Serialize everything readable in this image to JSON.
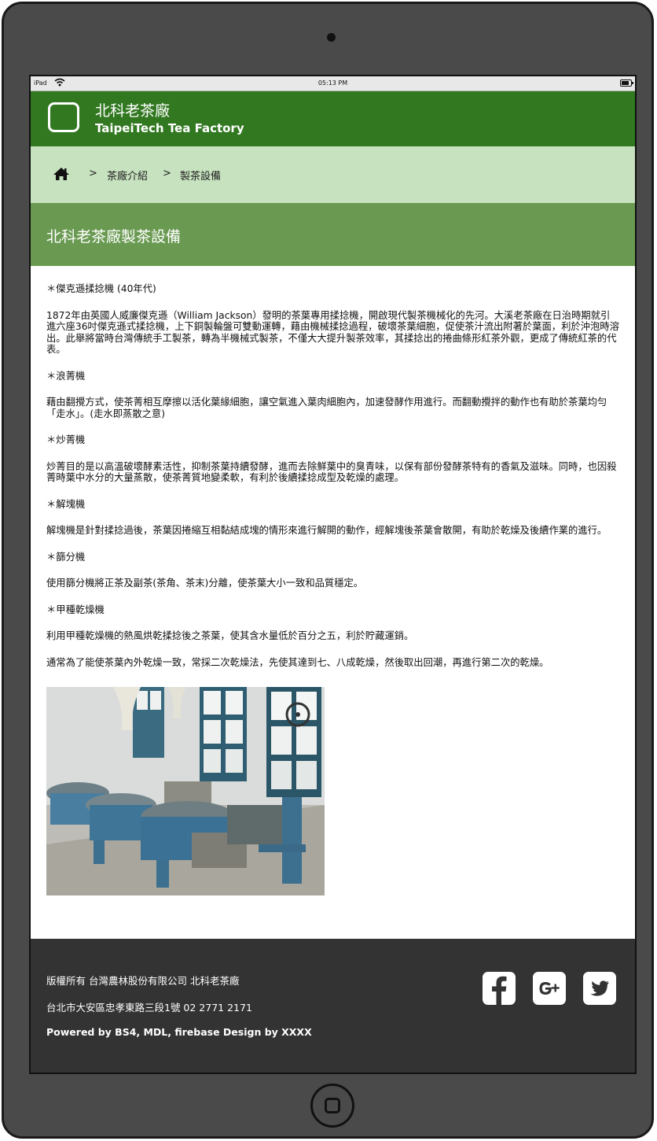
{
  "status_bar": {
    "device": "iPad",
    "time": "05:13 PM"
  },
  "header": {
    "title": "北科老茶廠",
    "subtitle": "TaipeiTech Tea Factory"
  },
  "breadcrumb": {
    "separator": ">",
    "items": [
      "茶廠介紹",
      "製茶設備"
    ]
  },
  "page": {
    "title": "北科老茶廠製茶設備"
  },
  "content": {
    "sections": [
      {
        "heading": "＊傑克遜揉捻機 (40年代)",
        "paragraphs": [
          "1872年由英國人威廉傑克遜（William Jackson）發明的茶葉專用揉捻機，開啟現代製茶機械化的先河。大溪老茶廠在日治時期就引進六座36吋傑克遜式揉捻機，上下銅製輪盤可雙動運轉，藉由機械揉捻過程，破壞茶葉細胞，促使茶汁流出附著於葉面，利於沖泡時溶出。此舉將當時台灣傳統手工製茶，轉為半機械式製茶，不僅大大提升製茶效率，其揉捻出的捲曲條形紅茶外觀，更成了傳統紅茶的代表。"
        ]
      },
      {
        "heading": "＊浪菁機",
        "paragraphs": [
          "藉由翻攪方式，使茶菁相互摩擦以活化葉緣細胞，讓空氣進入葉肉細胞內，加速發酵作用進行。而翻動攪拌的動作也有助於茶葉均勻「走水」。(走水即蒸散之意)"
        ]
      },
      {
        "heading": "＊炒菁機",
        "paragraphs": [
          "炒菁目的是以高溫破壞酵素活性，抑制茶葉持續發酵，進而去除鮮葉中的臭青味，以保有部份發酵茶特有的香氣及滋味。同時，也因殺菁時葉中水分的大量蒸散，使茶菁質地變柔軟，有利於後續揉捻成型及乾燥的處理。"
        ]
      },
      {
        "heading": "＊解塊機",
        "paragraphs": [
          "解塊機是針對揉捻過後，茶葉因捲縮互相黏結成塊的情形來進行解開的動作，經解塊後茶葉會散開，有助於乾燥及後續作業的進行。"
        ]
      },
      {
        "heading": "＊篩分機",
        "paragraphs": [
          "使用篩分機將正茶及副茶(茶角、茶末)分離，使茶葉大小一致和品質穩定。"
        ]
      },
      {
        "heading": "＊甲種乾燥機",
        "paragraphs": [
          "利用甲種乾燥機的熱風烘乾揉捻後之茶葉，使其含水量低於百分之五，利於貯藏運銷。",
          "通常為了能使茶葉內外乾燥一致，常採二次乾燥法，先使其達到七、八成乾燥，然後取出回潮，再進行第二次的乾燥。"
        ]
      }
    ]
  },
  "footer": {
    "copyright": "版權所有 台灣農林股份有限公司 北科老茶廠",
    "address": "台北市大安區忠孝東路三段1號 02 2771 2171",
    "powered": "Powered by BS4, MDL, firebase Design by XXXX",
    "social": [
      "facebook-icon",
      "google-plus-icon",
      "twitter-icon"
    ]
  },
  "colors": {
    "header_bg": "#317820",
    "breadcrumb_bg": "#c7e2bf",
    "banner_bg": "#6a9a52",
    "footer_bg": "#333333",
    "device_frame": "#4a4a4a"
  }
}
